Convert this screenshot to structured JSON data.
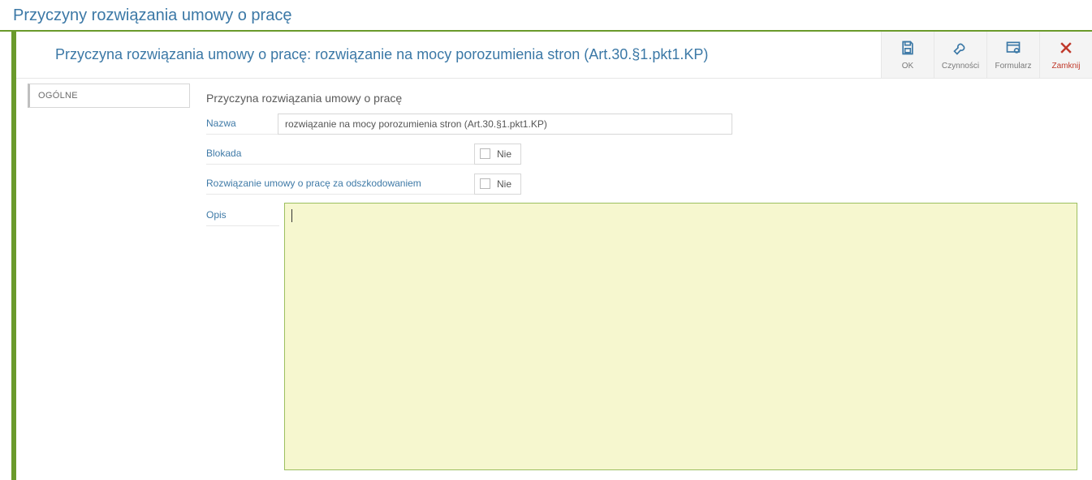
{
  "page_title": "Przyczyny rozwiązania umowy o pracę",
  "header": {
    "title": "Przyczyna rozwiązania umowy o pracę: rozwiązanie na mocy porozumienia stron (Art.30.§1.pkt1.KP)"
  },
  "toolbar": {
    "ok": "OK",
    "actions": "Czynności",
    "form": "Formularz",
    "close": "Zamknij"
  },
  "tabs": {
    "general": "OGÓLNE"
  },
  "form": {
    "section_title": "Przyczyna rozwiązania umowy o pracę",
    "name_label": "Nazwa",
    "name_value": "rozwiązanie na mocy porozumienia stron (Art.30.§1.pkt1.KP)",
    "lock_label": "Blokada",
    "lock_value_text": "Nie",
    "lock_checked": false,
    "comp_label": "Rozwiązanie umowy o pracę za odszkodowaniem",
    "comp_value_text": "Nie",
    "comp_checked": false,
    "desc_label": "Opis",
    "desc_value": ""
  }
}
